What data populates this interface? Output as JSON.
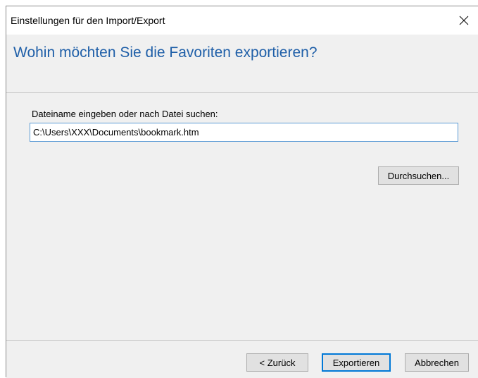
{
  "window": {
    "title": "Einstellungen für den Import/Export",
    "close_icon": "close-icon"
  },
  "header": {
    "title": "Wohin möchten Sie die Favoriten exportieren?"
  },
  "form": {
    "label": "Dateiname eingeben oder nach Datei suchen:",
    "path_value": "C:\\Users\\XXX\\Documents\\bookmark.htm",
    "browse_label": "Durchsuchen..."
  },
  "footer": {
    "back_label": "< Zurück",
    "export_label": "Exportieren",
    "cancel_label": "Abbrechen"
  },
  "colors": {
    "header_title": "#1f5fa8",
    "input_border": "#5b9bd5",
    "default_button_border": "#0078d7",
    "panel_background": "#f0f0f0"
  }
}
